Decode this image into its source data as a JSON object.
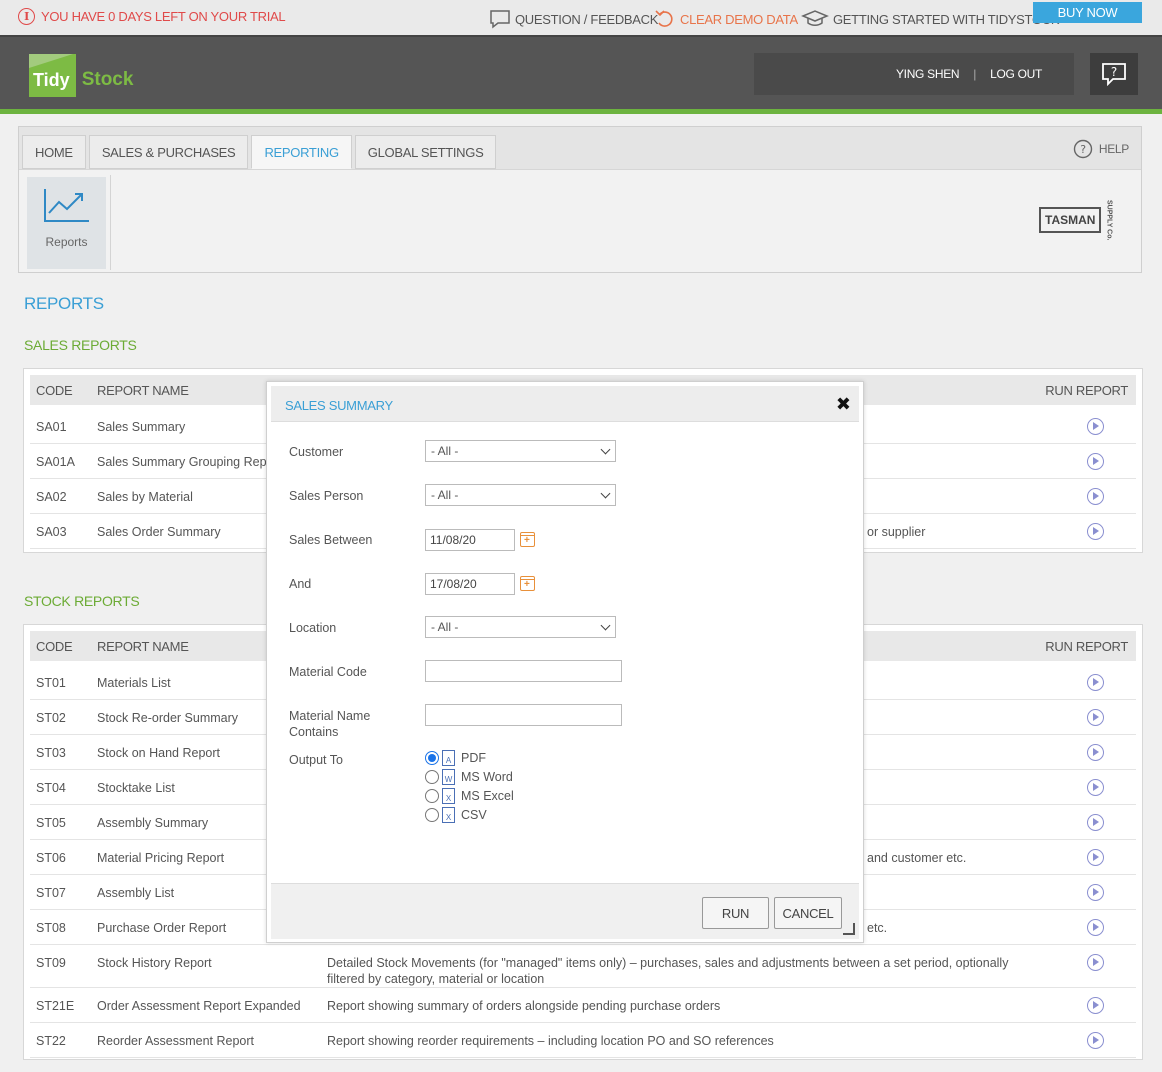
{
  "topbar": {
    "trial": "YOU HAVE 0 DAYS LEFT ON YOUR TRIAL",
    "question": "QUESTION / FEEDBACK",
    "clear": "CLEAR DEMO DATA",
    "getting_started": "GETTING STARTED WITH TIDYSTOCK",
    "buy": "BUY NOW"
  },
  "header": {
    "logo_a": "Tidy",
    "logo_b": "Stock",
    "user": "YING SHEN",
    "sep": "|",
    "logout": "LOG OUT"
  },
  "tabs": [
    "HOME",
    "SALES & PURCHASES",
    "REPORTING",
    "GLOBAL SETTINGS"
  ],
  "help": "HELP",
  "tile": "Reports",
  "tasman": {
    "main": "TASMAN",
    "side": "SUPPLY Co."
  },
  "page_title": "REPORTS",
  "sales_title": "SALES REPORTS",
  "stock_title": "STOCK REPORTS",
  "cols": {
    "code": "CODE",
    "name": "REPORT NAME",
    "run": "RUN REPORT"
  },
  "sales_rows": [
    {
      "code": "SA01",
      "name": "Sales Summary",
      "desc": ""
    },
    {
      "code": "SA01A",
      "name": "Sales Summary Grouping Repo",
      "desc": ""
    },
    {
      "code": "SA02",
      "name": "Sales by Material",
      "desc": ""
    },
    {
      "code": "SA03",
      "name": "Sales Order Summary",
      "desc": "or supplier"
    }
  ],
  "stock_rows": [
    {
      "code": "ST01",
      "name": "Materials List",
      "desc": ""
    },
    {
      "code": "ST02",
      "name": "Stock Re-order Summary",
      "desc": ""
    },
    {
      "code": "ST03",
      "name": "Stock on Hand Report",
      "desc": ""
    },
    {
      "code": "ST04",
      "name": "Stocktake List",
      "desc": ""
    },
    {
      "code": "ST05",
      "name": "Assembly Summary",
      "desc": ""
    },
    {
      "code": "ST06",
      "name": "Material Pricing Report",
      "desc": "and customer etc."
    },
    {
      "code": "ST07",
      "name": "Assembly List",
      "desc": ""
    },
    {
      "code": "ST08",
      "name": "Purchase Order Report",
      "desc": "etc."
    },
    {
      "code": "ST09",
      "name": "Stock History Report",
      "desc": "Detailed Stock Movements (for \"managed\" items only) – purchases, sales and adjustments between a set period, optionally",
      "desc2": "filtered by category, material or location"
    },
    {
      "code": "ST21E",
      "name": "Order Assessment Report Expanded",
      "desc": "Report showing summary of orders alongside pending purchase orders"
    },
    {
      "code": "ST22",
      "name": "Reorder Assessment Report",
      "desc": "Report showing reorder requirements – including location PO and SO references"
    }
  ],
  "modal": {
    "title": "SALES SUMMARY",
    "close": "✖",
    "customer_label": "Customer",
    "customer_value": "- All -",
    "salesperson_label": "Sales Person",
    "salesperson_value": "- All -",
    "between_label": "Sales Between",
    "between_value": "11/08/20",
    "and_label": "And",
    "and_value": "17/08/20",
    "location_label": "Location",
    "location_value": "- All -",
    "matcode_label": "Material Code",
    "matname_label_1": "Material Name",
    "matname_label_2": "Contains",
    "output_label": "Output To",
    "outputs": [
      {
        "label": "PDF",
        "glyph": "A",
        "selected": true
      },
      {
        "label": "MS Word",
        "glyph": "W",
        "selected": false
      },
      {
        "label": "MS Excel",
        "glyph": "X",
        "selected": false
      },
      {
        "label": "CSV",
        "glyph": "X",
        "selected": false
      }
    ],
    "run": "RUN",
    "cancel": "CANCEL"
  }
}
